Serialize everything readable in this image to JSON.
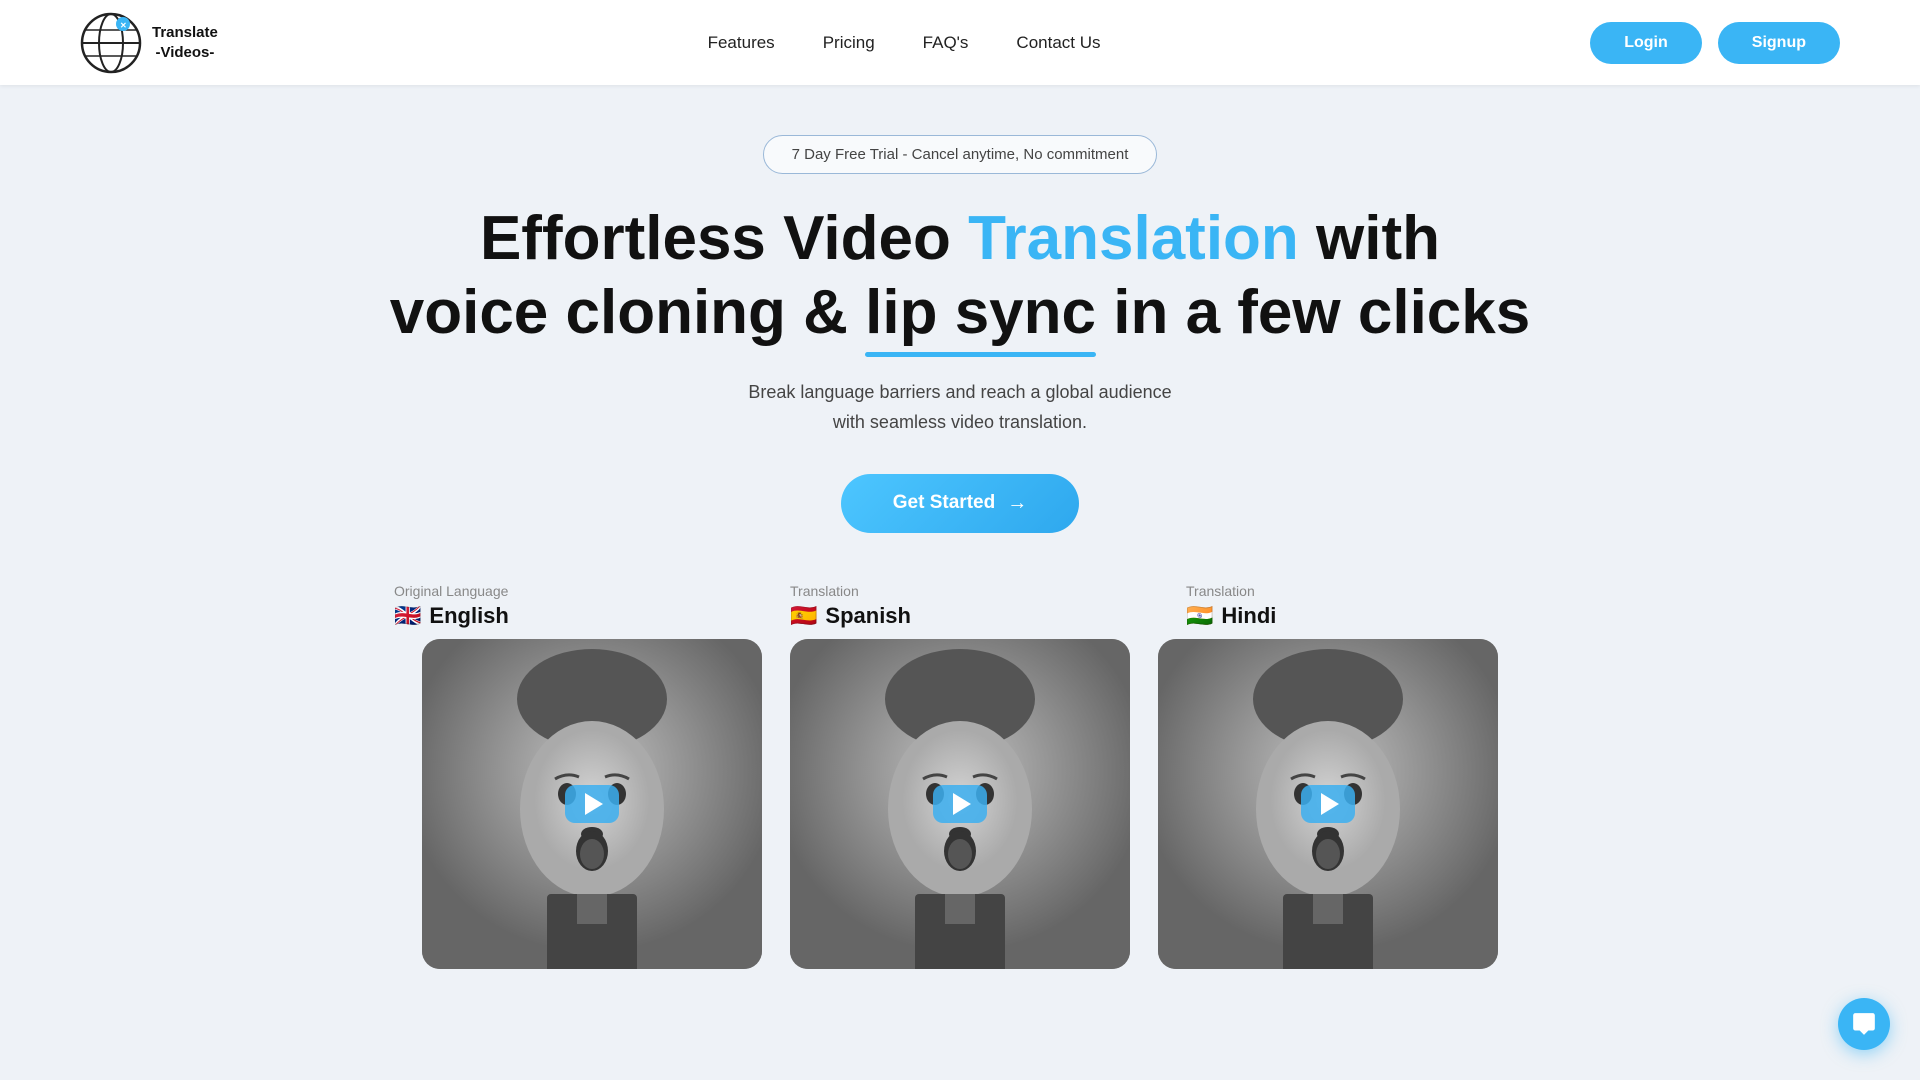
{
  "header": {
    "logo_line1": "Translate",
    "logo_line2": "-Videos-",
    "nav": {
      "features": "Features",
      "pricing": "Pricing",
      "faqs": "FAQ's",
      "contact": "Contact Us"
    },
    "login_label": "Login",
    "signup_label": "Signup"
  },
  "hero": {
    "trial_badge": "7 Day Free Trial - Cancel anytime, No commitment",
    "title_part1": "Effortless Video ",
    "title_highlight": "Translation",
    "title_part2": " with",
    "title_line2_part1": "voice cloning & ",
    "title_underline": "lip sync",
    "title_line2_part2": " in a few clicks",
    "subtitle_line1": "Break language barriers and reach a global audience",
    "subtitle_line2": "with seamless video translation.",
    "cta_button": "Get Started",
    "cta_arrow": "→"
  },
  "demo": {
    "columns": [
      {
        "label_title": "Original Language",
        "flag": "🇬🇧",
        "language": "English"
      },
      {
        "label_title": "Translation",
        "flag": "🇪🇸",
        "language": "Spanish"
      },
      {
        "label_title": "Translation",
        "flag": "🇮🇳",
        "language": "Hindi"
      }
    ]
  },
  "chat_bubble": {
    "aria_label": "Open chat"
  }
}
